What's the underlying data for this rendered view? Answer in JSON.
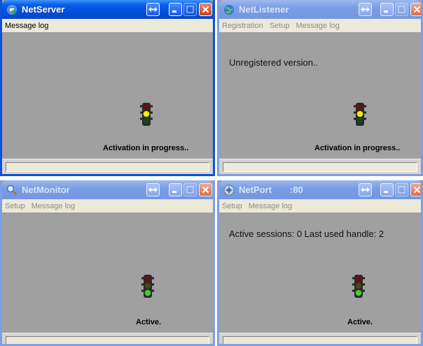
{
  "windows": {
    "netserver": {
      "title": "NetServer",
      "menu": [
        "Message log"
      ],
      "status": "Activation in progress..",
      "light": "yellow"
    },
    "netlistener": {
      "title": "NetListener",
      "menu": [
        "Registration",
        "Setup",
        "Message log"
      ],
      "message": "Unregistered version..",
      "status": "Activation in progress..",
      "light": "yellow"
    },
    "netmonitor": {
      "title": "NetMonitor",
      "menu": [
        "Setup",
        "Message log"
      ],
      "status": "Active.",
      "light": "green"
    },
    "netport": {
      "title": "NetPort",
      "title_port": ":80",
      "menu": [
        "Setup",
        "Message log"
      ],
      "message": "Active sessions: 0 Last used handle: 2",
      "status": "Active.",
      "light": "green"
    }
  },
  "icons": {
    "netserver": "server-app-icon",
    "netlistener": "globe-icon",
    "netmonitor": "magnifier-icon",
    "netport": "globe-arrows-icon"
  },
  "colors": {
    "active_titlebar": "#0a5ee8",
    "inactive_titlebar": "#7a9ee6",
    "client_area": "#a0a0a0",
    "light_yellow": "#f2ee00",
    "light_green": "#3ccf2e",
    "light_red_off": "#6b1010"
  }
}
